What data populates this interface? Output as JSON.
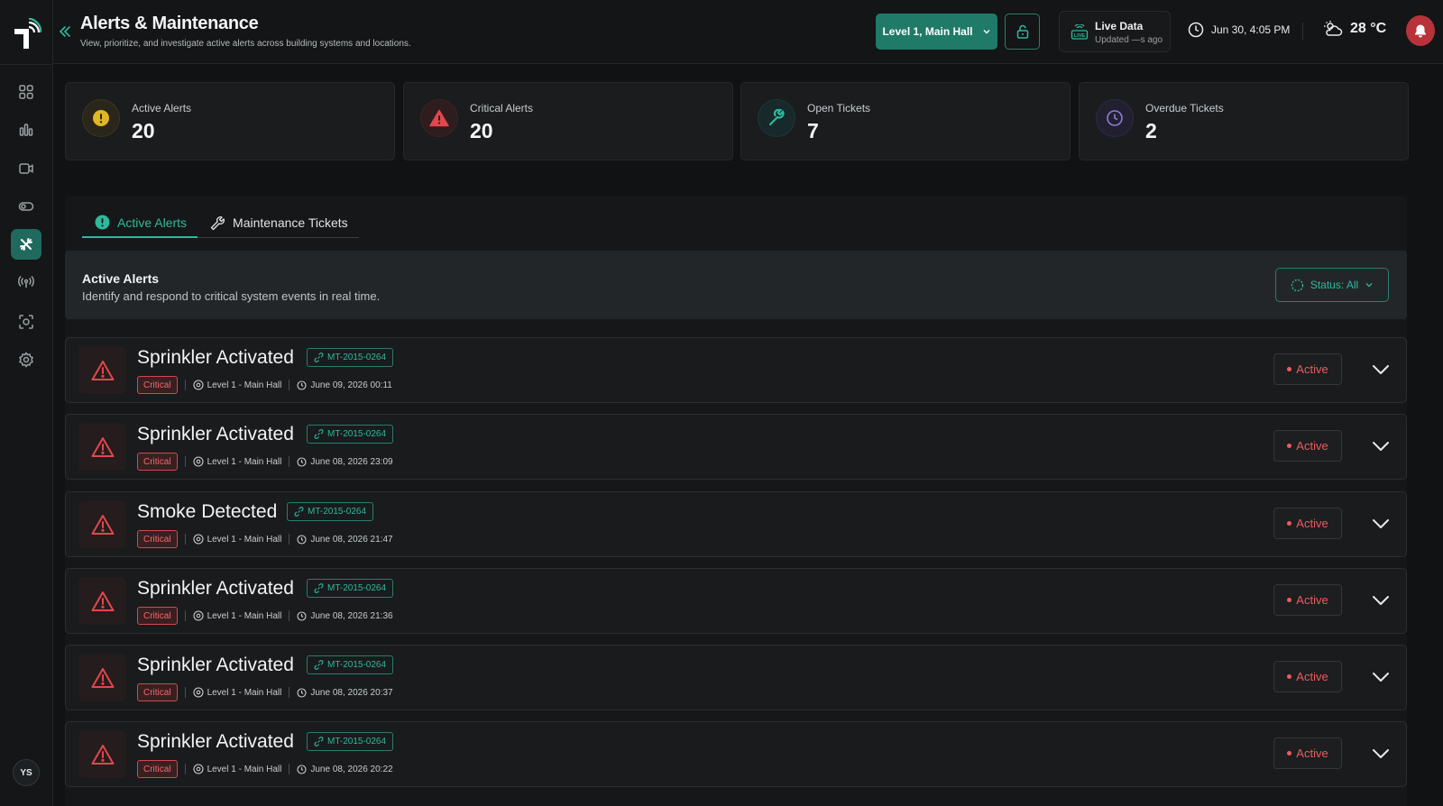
{
  "header": {
    "title": "Alerts & Maintenance",
    "subtitle": "View, prioritize, and investigate active alerts across building systems and locations.",
    "location": "Level 1, Main Hall",
    "live_title": "Live Data",
    "live_sub": "Updated —s ago",
    "datetime": "Jun 30, 4:05 PM",
    "temperature": "28 °C"
  },
  "sidebar": {
    "avatar_initials": "YS",
    "items": [
      {
        "icon": "grid-icon"
      },
      {
        "icon": "bar-chart-icon"
      },
      {
        "icon": "camera-icon"
      },
      {
        "icon": "toggle-icon"
      },
      {
        "icon": "tools-icon",
        "active": true
      },
      {
        "icon": "signal-icon"
      },
      {
        "icon": "scan-icon"
      },
      {
        "icon": "settings-icon"
      }
    ]
  },
  "stats": [
    {
      "label": "Active Alerts",
      "value": "20",
      "icon": "warning-circle-icon",
      "color": "#e0b624"
    },
    {
      "label": "Critical Alerts",
      "value": "20",
      "icon": "warning-triangle-icon",
      "color": "#e2474d"
    },
    {
      "label": "Open Tickets",
      "value": "7",
      "icon": "wrench-icon",
      "color": "#2fb99d"
    },
    {
      "label": "Overdue Tickets",
      "value": "2",
      "icon": "clock-icon",
      "color": "#8b7fd6"
    }
  ],
  "tabs": [
    {
      "label": "Active Alerts",
      "active": true
    },
    {
      "label": "Maintenance Tickets",
      "active": false
    }
  ],
  "section": {
    "title": "Active Alerts",
    "subtitle": "Identify and respond to critical system events in real time.",
    "filter_label": "Status: All"
  },
  "alerts": [
    {
      "title": "Sprinkler Activated",
      "id": "MT-2015-0264",
      "severity": "Critical",
      "location": "Level 1 - Main Hall",
      "time": "June 09, 2026 00:11",
      "status": "Active"
    },
    {
      "title": "Sprinkler Activated",
      "id": "MT-2015-0264",
      "severity": "Critical",
      "location": "Level 1 - Main Hall",
      "time": "June 08, 2026 23:09",
      "status": "Active"
    },
    {
      "title": "Smoke Detected",
      "id": "MT-2015-0264",
      "severity": "Critical",
      "location": "Level 1 - Main Hall",
      "time": "June 08, 2026 21:47",
      "status": "Active"
    },
    {
      "title": "Sprinkler Activated",
      "id": "MT-2015-0264",
      "severity": "Critical",
      "location": "Level 1 - Main Hall",
      "time": "June 08, 2026 21:36",
      "status": "Active"
    },
    {
      "title": "Sprinkler Activated",
      "id": "MT-2015-0264",
      "severity": "Critical",
      "location": "Level 1 - Main Hall",
      "time": "June 08, 2026 20:37",
      "status": "Active"
    },
    {
      "title": "Sprinkler Activated",
      "id": "MT-2015-0264",
      "severity": "Critical",
      "location": "Level 1 - Main Hall",
      "time": "June 08, 2026 20:22",
      "status": "Active"
    }
  ]
}
